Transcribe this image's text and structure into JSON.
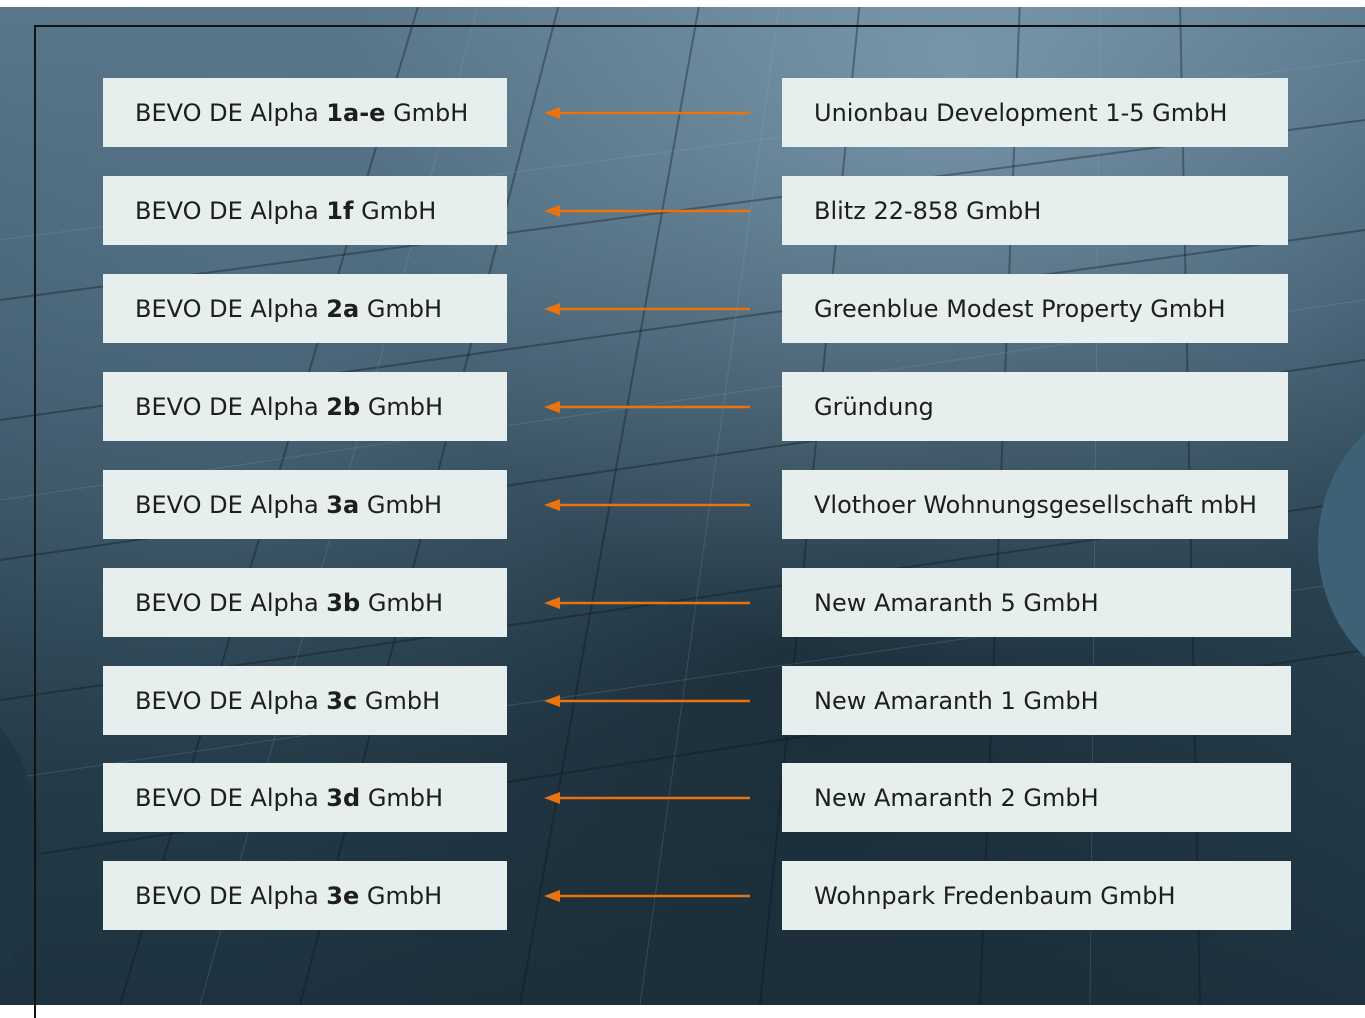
{
  "mappings": [
    {
      "target_prefix": "BEVO DE Alpha ",
      "target_code": "1a-e",
      "target_suffix": " GmbH",
      "source": "Unionbau Development 1-5 GmbH"
    },
    {
      "target_prefix": "BEVO DE Alpha ",
      "target_code": "1f",
      "target_suffix": " GmbH",
      "source": "Blitz 22-858 GmbH"
    },
    {
      "target_prefix": "BEVO DE Alpha ",
      "target_code": "2a",
      "target_suffix": " GmbH",
      "source": "Greenblue Modest Property GmbH"
    },
    {
      "target_prefix": "BEVO DE Alpha ",
      "target_code": "2b",
      "target_suffix": " GmbH",
      "source": "Gründung"
    },
    {
      "target_prefix": "BEVO DE Alpha ",
      "target_code": "3a",
      "target_suffix": " GmbH",
      "source": "Vlothoer Wohnungsgesellschaft mbH"
    },
    {
      "target_prefix": "BEVO DE Alpha ",
      "target_code": "3b",
      "target_suffix": " GmbH",
      "source": "New Amaranth 5 GmbH"
    },
    {
      "target_prefix": "BEVO DE Alpha ",
      "target_code": "3c",
      "target_suffix": " GmbH",
      "source": "New Amaranth 1 GmbH"
    },
    {
      "target_prefix": "BEVO DE Alpha ",
      "target_code": "3d",
      "target_suffix": " GmbH",
      "source": "New Amaranth 2 GmbH"
    },
    {
      "target_prefix": "BEVO DE Alpha ",
      "target_code": "3e",
      "target_suffix": " GmbH",
      "source": "Wohnpark Fredenbaum GmbH"
    }
  ],
  "colors": {
    "arrow": "#e8730f",
    "box_fill": "#e7eeee",
    "text": "#1e1e1e"
  }
}
